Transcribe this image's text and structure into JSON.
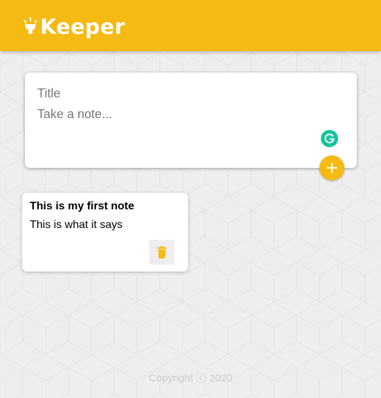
{
  "app": {
    "name": "Keeper"
  },
  "create_note": {
    "title_placeholder": "Title",
    "content_placeholder": "Take a note...",
    "title_value": "",
    "content_value": ""
  },
  "notes": [
    {
      "title": "This is my first note",
      "content": "This is what it says"
    }
  ],
  "footer": {
    "copyright": "Copyright ⓒ 2020"
  },
  "icons": {
    "logo": "lightbulb-icon",
    "add": "plus-icon",
    "delete": "trash-icon",
    "grammarly": "grammarly-icon"
  },
  "colors": {
    "accent": "#f5ba13",
    "background": "#eeeeee",
    "card": "#ffffff",
    "grammarly": "#15c39a",
    "footer_text": "#cccccc"
  }
}
